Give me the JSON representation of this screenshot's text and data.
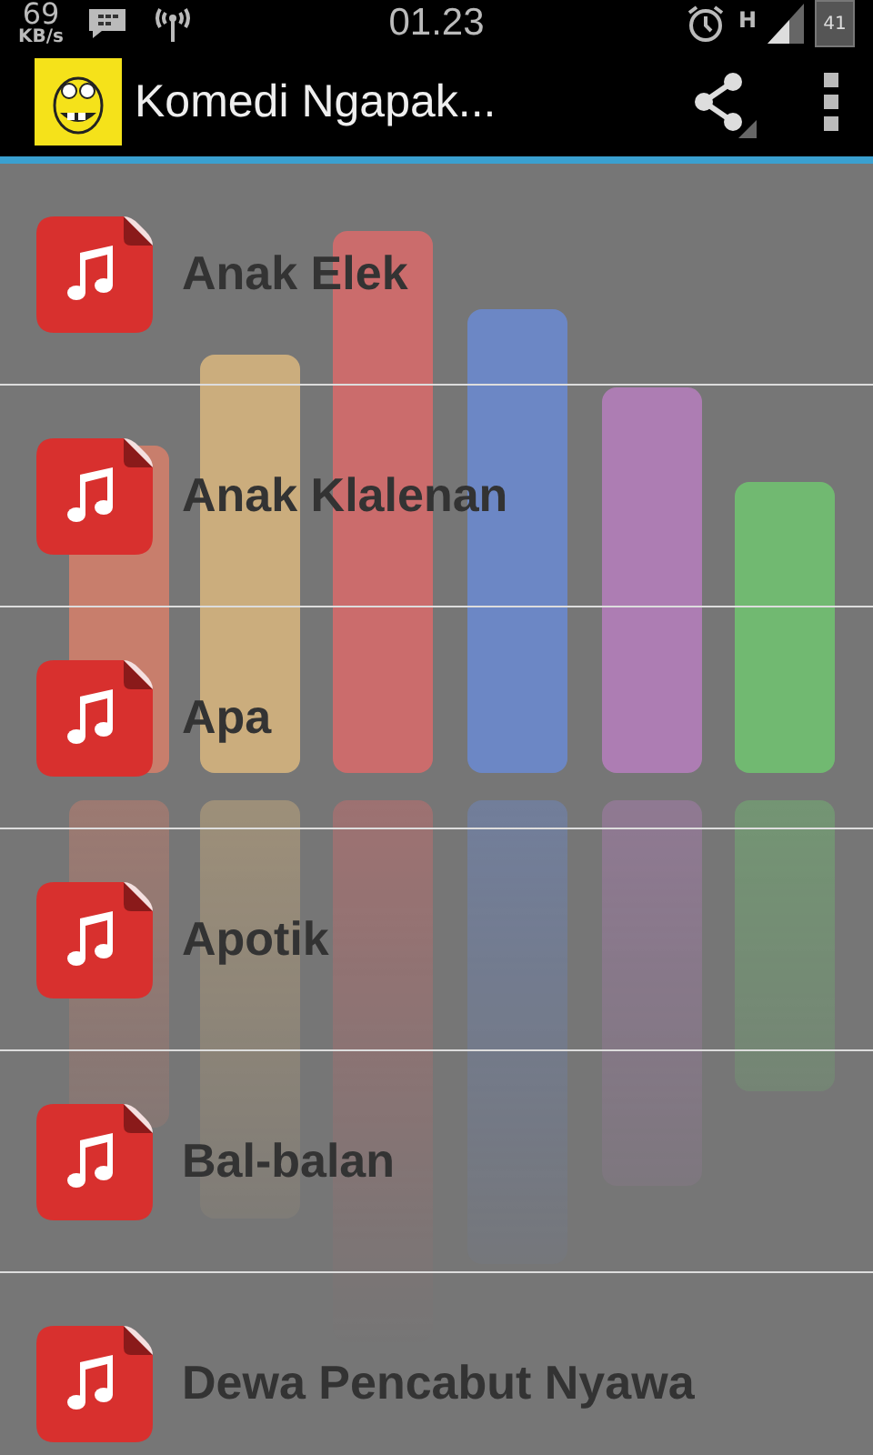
{
  "status_bar": {
    "speed": "69",
    "speed_unit": "KB/s",
    "time": "01.23",
    "network_type": "H",
    "battery": "41"
  },
  "action_bar": {
    "title": "Komedi Ngapak..."
  },
  "songs": [
    {
      "title": "Anak Elek"
    },
    {
      "title": "Anak Klalenan"
    },
    {
      "title": "Apa"
    },
    {
      "title": "Apotik"
    },
    {
      "title": "Bal-balan"
    },
    {
      "title": "Dewa Pencabut Nyawa"
    }
  ]
}
